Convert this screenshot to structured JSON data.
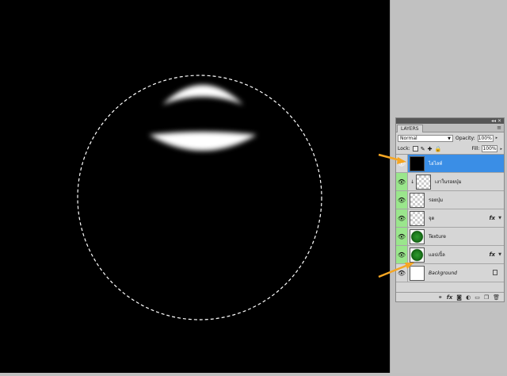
{
  "panel": {
    "tab_label": "LAYERS",
    "top_controls": "◂◂ ✕",
    "menu_icon": "≡",
    "blend_mode": "Normal",
    "opacity_label": "Opacity:",
    "opacity_value": "100%",
    "lock_label": "Lock:",
    "fill_label": "Fill:",
    "fill_value": "100%"
  },
  "layers": [
    {
      "name": "ไฮไลท์",
      "thumb": "black",
      "selected": true,
      "eye": "gray"
    },
    {
      "name": "เงาในรอยบุ๋ม",
      "thumb": "transparent",
      "clipped": true,
      "eye": "green"
    },
    {
      "name": "รอยบุ๋ม",
      "thumb": "transparent",
      "eye": "green"
    },
    {
      "name": "จุด",
      "thumb": "transparent",
      "fx": "fx",
      "eye": "green"
    },
    {
      "name": "Texture",
      "thumb": "green",
      "eye": "green"
    },
    {
      "name": "แอปเปิ้ล",
      "thumb": "green",
      "fx": "fx",
      "eye": "green"
    },
    {
      "name": "Background",
      "thumb": "white",
      "locked": true,
      "eye": "gray"
    }
  ],
  "bottom_icons": [
    "link-icon",
    "fx-icon",
    "mask-icon",
    "adjustment-icon",
    "group-icon",
    "new-layer-icon",
    "trash-icon"
  ],
  "colors": {
    "selection": "#3a8ee6",
    "visibility": "#9ae68c",
    "annotation_arrow": "#f5a623"
  }
}
